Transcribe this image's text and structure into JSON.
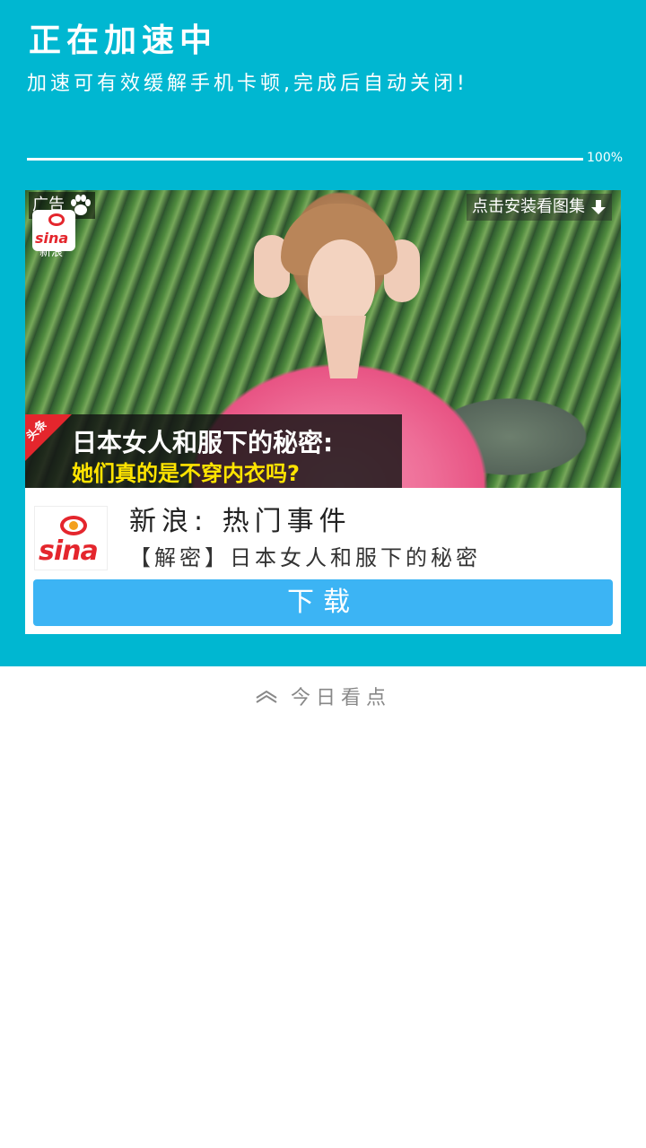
{
  "header": {
    "title": "正在加速中",
    "subtitle": "加速可有效缓解手机卡顿,完成后自动关闭!"
  },
  "progress": {
    "value": 1.0,
    "label": "100%"
  },
  "ad": {
    "badge_label": "广告",
    "badge_icon": "paw-icon",
    "source_mini_label": "新浪",
    "install_label": "点击安装看图集",
    "install_icon": "download-arrow-icon",
    "tag_label": "头条",
    "headline_line1": "日本女人和服下的秘密:",
    "headline_line2": "她们真的是不穿内衣吗?",
    "logo_text": "sina",
    "app_name": "新浪: 热门事件",
    "description": "【解密】日本女人和服下的秘密",
    "download_button": "下载"
  },
  "feed": {
    "section_label": "今日看点",
    "section_icon": "chevron-up-icon"
  },
  "colors": {
    "panel": "#00b7d1",
    "button": "#3cb4f4",
    "sina_red": "#e4262d",
    "headline_yellow": "#ffe400"
  }
}
